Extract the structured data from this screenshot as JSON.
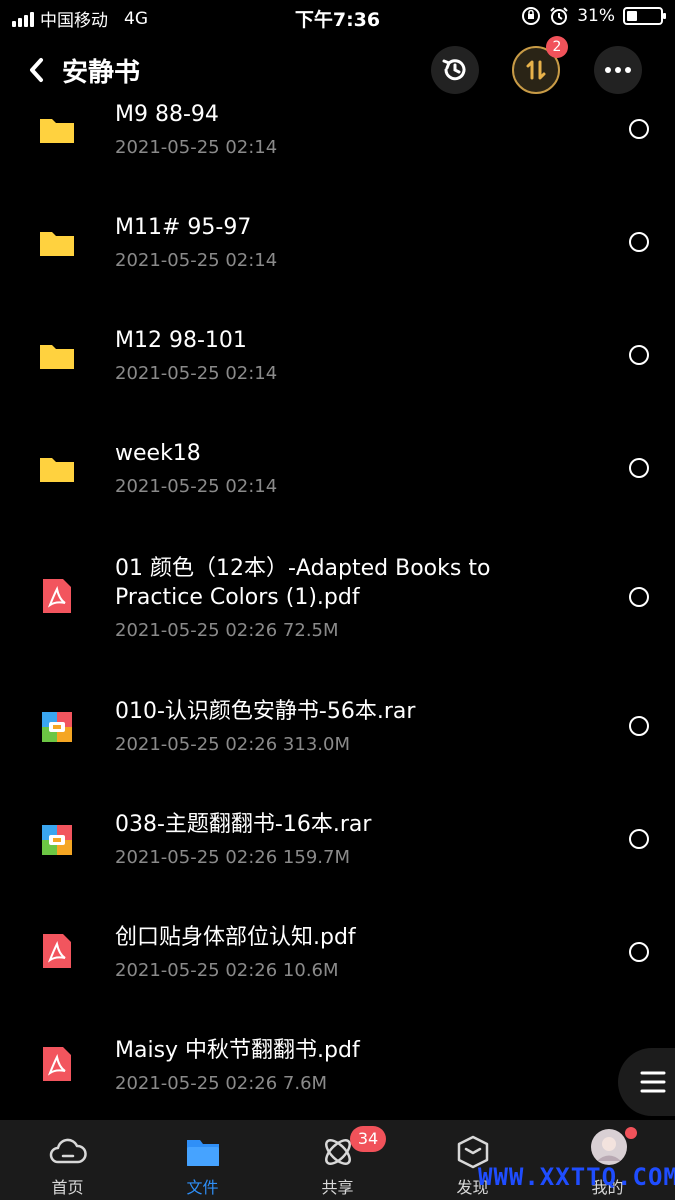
{
  "status_bar": {
    "carrier": "中国移动",
    "network": "4G",
    "time": "下午7:36",
    "battery": "31%",
    "battery_level": 0.31
  },
  "header": {
    "title": "安静书",
    "transfer_badge": "2"
  },
  "items": [
    {
      "type": "folder",
      "name": "M9  88-94",
      "meta": "2021-05-25 02:14"
    },
    {
      "type": "folder",
      "name": "M11# 95-97",
      "meta": "2021-05-25 02:14"
    },
    {
      "type": "folder",
      "name": "M12  98-101",
      "meta": "2021-05-25 02:14"
    },
    {
      "type": "folder",
      "name": "week18",
      "meta": "2021-05-25 02:14"
    },
    {
      "type": "pdf",
      "name": "01 颜色（12本）-Adapted Books to",
      "name2": "Practice Colors (1).pdf",
      "meta": "2021-05-25 02:26   72.5M"
    },
    {
      "type": "rar",
      "name": "010-认识颜色安静书-56本.rar",
      "meta": "2021-05-25 02:26   313.0M"
    },
    {
      "type": "rar",
      "name": "038-主题翻翻书-16本.rar",
      "meta": "2021-05-25 02:26   159.7M"
    },
    {
      "type": "pdf",
      "name": "创口贴身体部位认知.pdf",
      "meta": "2021-05-25 02:26   10.6M"
    },
    {
      "type": "pdf",
      "name": "Maisy 中秋节翻翻书.pdf",
      "meta": "2021-05-25 02:26   7.6M"
    }
  ],
  "tabs": [
    {
      "label": "首页",
      "icon": "cloud-icon"
    },
    {
      "label": "文件",
      "icon": "folder-icon",
      "active": true
    },
    {
      "label": "共享",
      "icon": "atom-icon",
      "badge": "34"
    },
    {
      "label": "发现",
      "icon": "box-icon"
    },
    {
      "label": "我的",
      "icon": "avatar-icon"
    }
  ],
  "watermark": "WWW.XXTTQ.COM",
  "colors": {
    "folder": "#ffd23f",
    "pdf": "#f2555e",
    "accent": "#2f8ff7",
    "badge": "#f1525a"
  }
}
